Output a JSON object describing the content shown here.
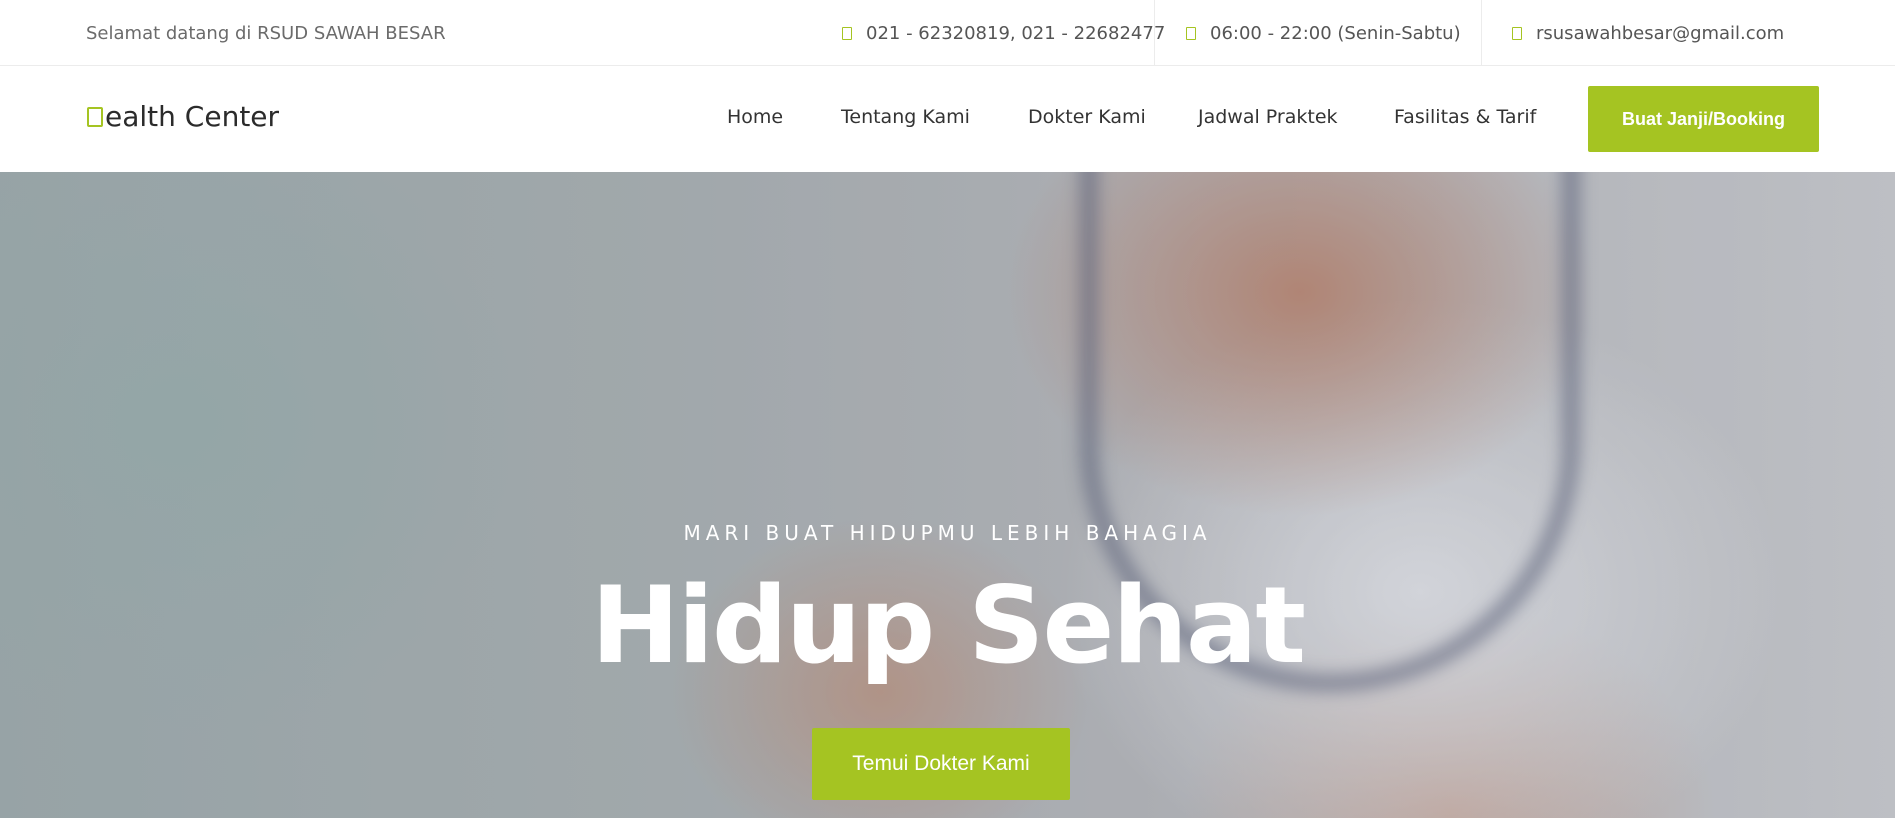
{
  "topbar": {
    "welcome": "Selamat datang di RSUD SAWAH BESAR",
    "phone": "021 - 62320819, 021 - 22682477",
    "phone_icon": "phone-icon",
    "hours": "06:00 - 22:00 (Senin-Sabtu)",
    "hours_icon": "clock-icon",
    "email": "rsusawahbesar@gmail.com",
    "email_icon": "mail-icon"
  },
  "navbar": {
    "logo_text": "ealth Center",
    "logo_icon": "heart-icon",
    "items": [
      {
        "label": "Home"
      },
      {
        "label": "Tentang Kami"
      },
      {
        "label": "Dokter Kami"
      },
      {
        "label": "Jadwal Praktek"
      },
      {
        "label": "Fasilitas & Tarif"
      }
    ],
    "book_label": "Buat Janji/Booking"
  },
  "hero": {
    "subtitle": "MARI BUAT HIDUPMU LEBIH BAHAGIA",
    "title": "Hidup Sehat",
    "cta_label": "Temui Dokter Kami"
  },
  "colors": {
    "accent": "#a5c422",
    "text": "#333333",
    "muted": "#6b6b6b"
  }
}
